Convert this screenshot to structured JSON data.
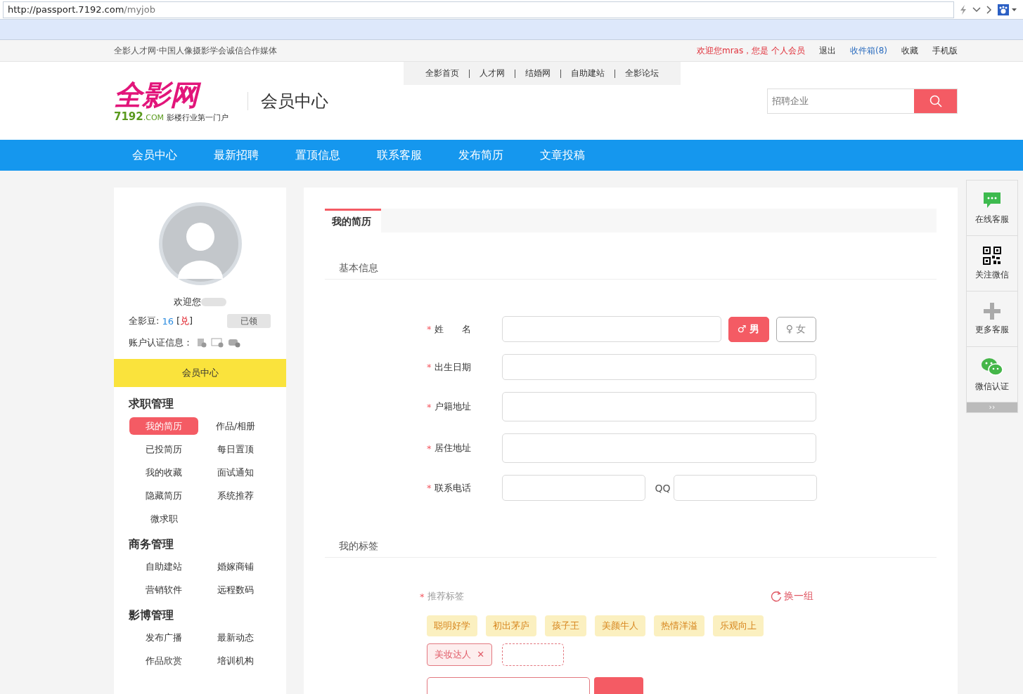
{
  "browser": {
    "url_host": "http://passport.7192.com",
    "url_path": "/myjob"
  },
  "topbar": {
    "slogan": "全影人才网·中国人像摄影学会诚信合作媒体",
    "welcome": "欢迎您mras，您是 个人会员",
    "links": [
      {
        "label": "退出",
        "kind": "plain"
      },
      {
        "label": "收件箱(8)",
        "kind": "blue"
      },
      {
        "label": "收藏",
        "kind": "plain"
      },
      {
        "label": "手机版",
        "kind": "plain"
      }
    ]
  },
  "header": {
    "logo_main": "全影网",
    "logo_num": "7192",
    "logo_com": ".COM",
    "logo_tagline": "影楼行业第一门户",
    "title": "会员中心",
    "sitelinks": [
      "全影首页",
      "人才网",
      "结婚网",
      "自助建站",
      "全影论坛"
    ],
    "search": {
      "placeholder": "招聘企业"
    }
  },
  "nav": [
    "会员中心",
    "最新招聘",
    "置顶信息",
    "联系客服",
    "发布简历",
    "文章投稿"
  ],
  "sidebar": {
    "welcome": "欢迎您",
    "beans_label": "全影豆:",
    "beans": "16",
    "exchange_open": "[",
    "exchange": "兑",
    "exchange_close": "]",
    "claim": "已领",
    "cert_label": "账户认证信息：",
    "member_center": "会员中心",
    "sections": [
      {
        "title": "求职管理",
        "items": [
          {
            "label": "我的简历",
            "selected": true
          },
          {
            "label": "作品/相册",
            "selected": false
          },
          {
            "label": "已投简历",
            "selected": false
          },
          {
            "label": "每日置顶",
            "selected": false
          },
          {
            "label": "我的收藏",
            "selected": false
          },
          {
            "label": "面试通知",
            "selected": false
          },
          {
            "label": "隐藏简历",
            "selected": false
          },
          {
            "label": "系统推荐",
            "selected": false
          },
          {
            "label": "微求职",
            "selected": false
          }
        ]
      },
      {
        "title": "商务管理",
        "items": [
          {
            "label": "自助建站",
            "selected": false
          },
          {
            "label": "婚嫁商铺",
            "selected": false
          },
          {
            "label": "营销软件",
            "selected": false
          },
          {
            "label": "远程数码",
            "selected": false
          }
        ]
      },
      {
        "title": "影博管理",
        "items": [
          {
            "label": "发布广播",
            "selected": false
          },
          {
            "label": "最新动态",
            "selected": false
          },
          {
            "label": "作品欣赏",
            "selected": false
          },
          {
            "label": "培训机构",
            "selected": false
          }
        ]
      }
    ]
  },
  "main": {
    "required_mark": "*",
    "tabs": [
      {
        "label": "我的简历",
        "selected": true
      }
    ],
    "basic_title": "基本信息",
    "fields": [
      {
        "label": "姓　　名",
        "kind": "name"
      },
      {
        "label": "出生日期",
        "kind": "text"
      },
      {
        "label": "户籍地址",
        "kind": "text"
      },
      {
        "label": "居住地址",
        "kind": "text"
      },
      {
        "label": "联系电话",
        "kind": "phone",
        "extra_label": "QQ"
      }
    ],
    "genders": [
      {
        "symbol": "♂",
        "label": "男",
        "selected": true
      },
      {
        "symbol": "♀",
        "label": "女",
        "selected": false
      }
    ],
    "tags_title": "我的标签",
    "recommend_label": "推荐标签",
    "refresh": "换一组",
    "recommended": [
      "聪明好学",
      "初出茅庐",
      "孩子王",
      "美颜牛人",
      "热情洋溢",
      "乐观向上"
    ],
    "chosen": [
      {
        "label": "美妆达人",
        "remove": "✕"
      }
    ]
  },
  "float": [
    {
      "label": "在线客服",
      "kind": "chat"
    },
    {
      "label": "关注微信",
      "kind": "qr"
    },
    {
      "label": "更多客服",
      "kind": "plus"
    },
    {
      "label": "微信认证",
      "kind": "wechat"
    }
  ],
  "float_more": "››"
}
